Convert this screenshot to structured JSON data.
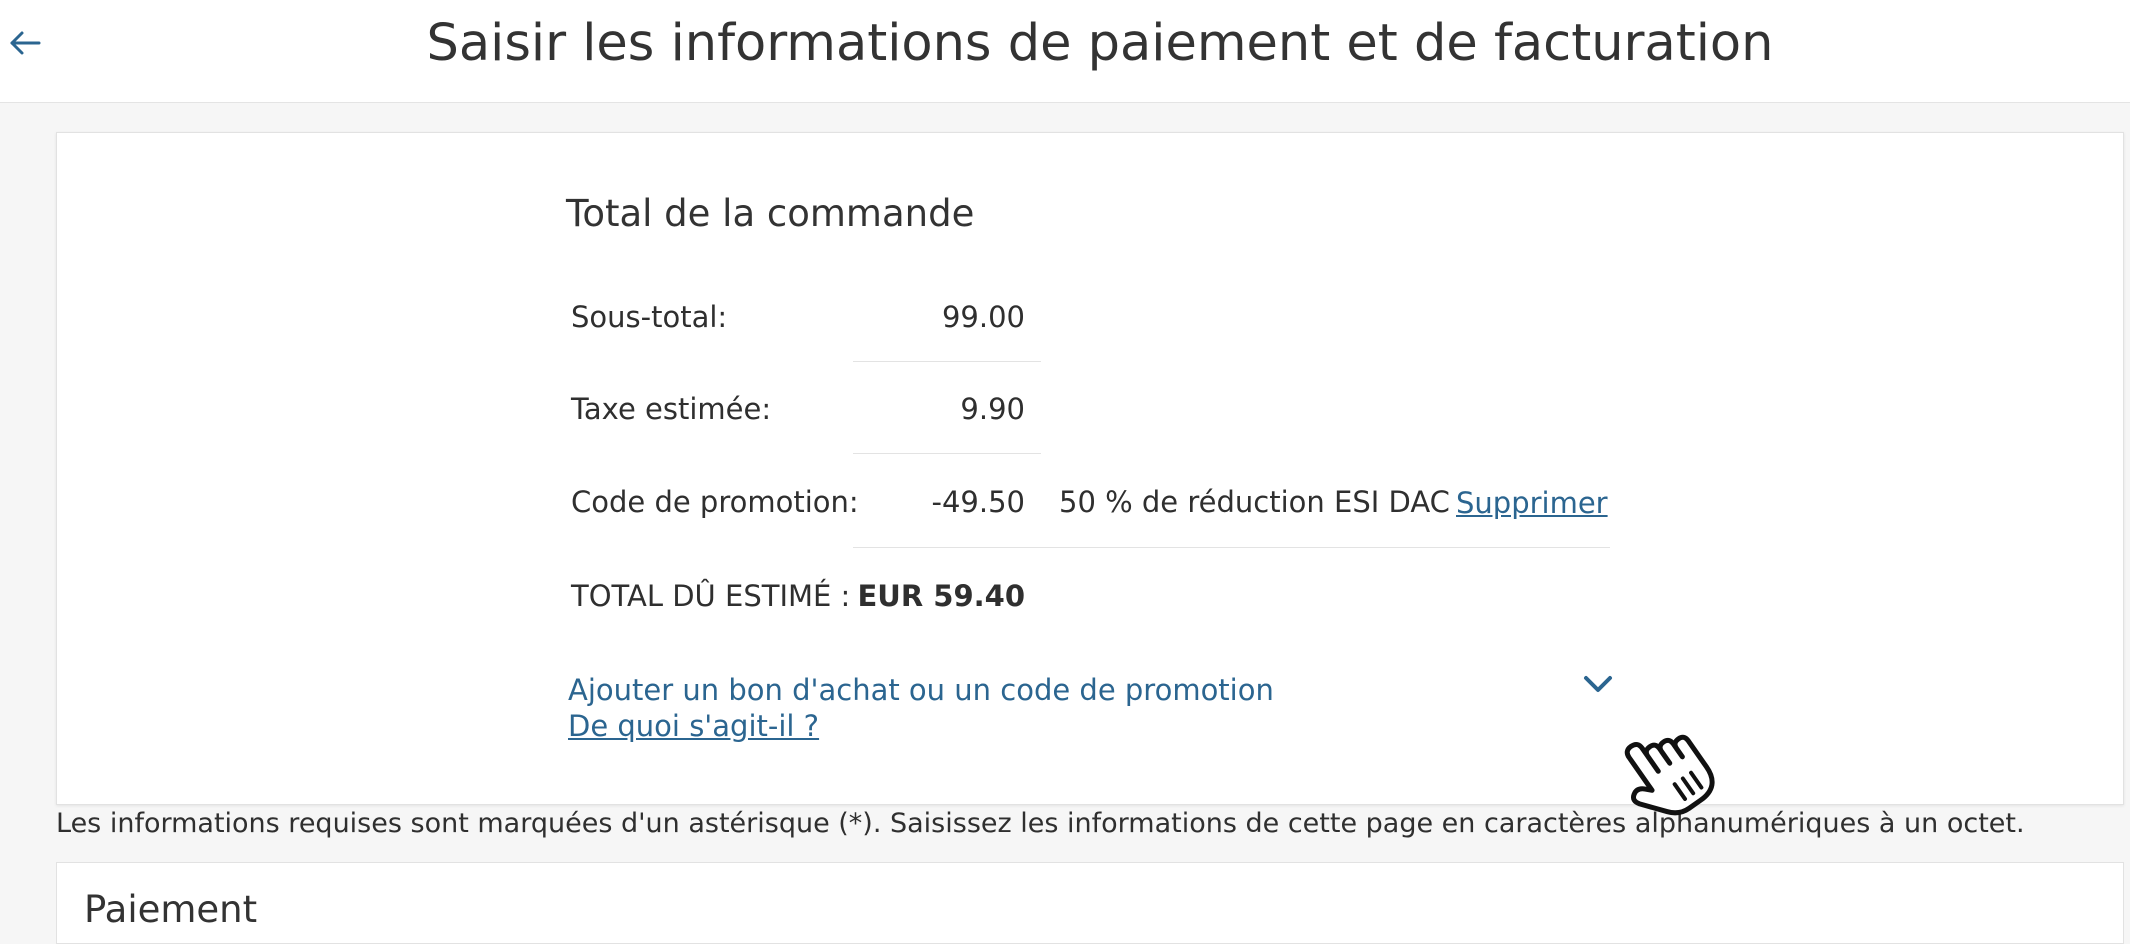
{
  "header": {
    "title": "Saisir les informations de paiement et de facturation"
  },
  "order_total": {
    "heading": "Total de la commande",
    "rows": [
      {
        "label": "Sous-total:",
        "value": "99.00"
      },
      {
        "label": "Taxe estimée:",
        "value": "9.90"
      },
      {
        "label": "Code de promotion:",
        "value": "-49.50",
        "description": "50 % de réduction ESI DAC",
        "action": "Supprimer"
      },
      {
        "label": "TOTAL DÛ ESTIMÉ :",
        "value": "EUR 59.40"
      }
    ],
    "add_promo_label": "Ajouter un bon d'achat ou un code de promotion",
    "what_is_it_label": "De quoi s'agit-il ?"
  },
  "required_note": "Les informations requises sont marquées d'un astérisque (*). Saisissez les informations de cette page en caractères alphanumériques à un octet.",
  "payment": {
    "heading": "Paiement"
  },
  "icons": {
    "back": "arrow-left-icon",
    "expand": "chevron-down-icon",
    "cursor": "hand-pointer-icon"
  },
  "colors": {
    "link": "#2b6590",
    "background": "#f6f6f6",
    "card": "#ffffff",
    "text": "#2f2f2f"
  }
}
